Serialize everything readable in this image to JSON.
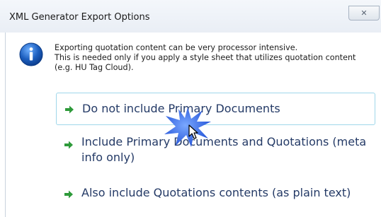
{
  "dialog": {
    "title": "XML Generator Export Options",
    "close_glyph": "✕"
  },
  "message": {
    "icon": "info-icon",
    "lines": [
      "Exporting quotation content can be very processor intensive.",
      "This is needed only if you apply a style sheet that utilizes quotation content",
      "(e.g. HU Tag Cloud)."
    ]
  },
  "options": [
    {
      "label": "Do not include Primary Documents",
      "icon": "green-arrow-icon",
      "highlighted": true
    },
    {
      "label": "Include Primary Documents and Quotations (meta info only)",
      "icon": "green-arrow-icon",
      "highlighted": false
    },
    {
      "label": "Also include Quotations contents (as plain text)",
      "icon": "green-arrow-icon",
      "highlighted": false
    }
  ],
  "colors": {
    "accent_green": "#2e9a3a",
    "option_text": "#243a66",
    "highlight_border": "#9fd7ea",
    "info_blue": "#1d5fbf"
  }
}
